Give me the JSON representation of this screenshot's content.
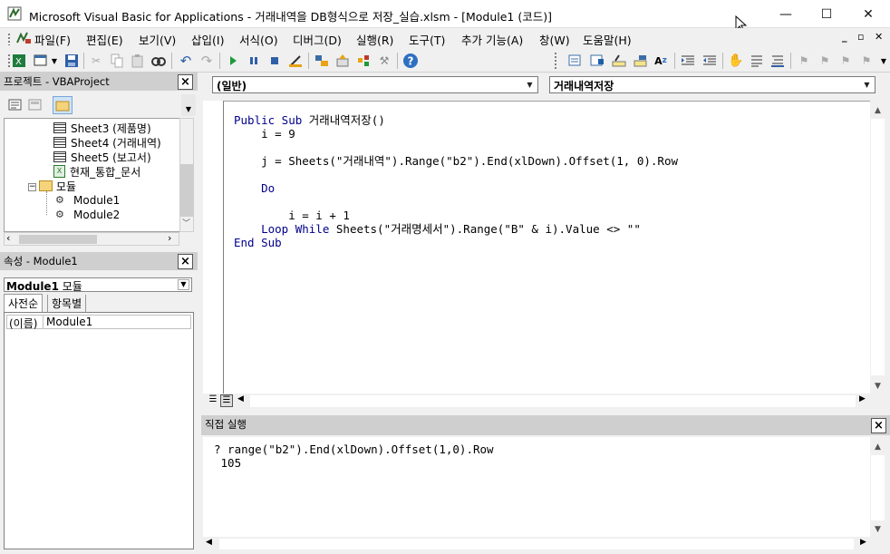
{
  "window": {
    "title": "Microsoft Visual Basic for Applications - 거래내역을 DB형식으로 저장_실습.xlsm - [Module1 (코드)]",
    "minimize_glyph": "—",
    "maximize_glyph": "☐",
    "close_glyph": "✕"
  },
  "menu": {
    "items": [
      "파일(F)",
      "편집(E)",
      "보기(V)",
      "삽입(I)",
      "서식(O)",
      "디버그(D)",
      "실행(R)",
      "도구(T)",
      "추가 기능(A)",
      "창(W)",
      "도움말(H)"
    ],
    "mdi_min": "_",
    "mdi_restore": "▫",
    "mdi_close": "✕"
  },
  "toolbar": {
    "icons": [
      "excel-icon",
      "insert-module-icon",
      "save-icon",
      "cut-icon",
      "copy-icon",
      "paste-icon",
      "find-icon",
      "undo-icon",
      "redo-icon",
      "run-icon",
      "break-icon",
      "reset-icon",
      "design-mode-icon",
      "project-explorer-icon",
      "properties-icon",
      "object-browser-icon",
      "toolbox-icon",
      "help-icon"
    ]
  },
  "project": {
    "title": "프로젝트 - VBAProject",
    "tree": [
      {
        "label": "Sheet3 (제품명)",
        "kind": "sheet"
      },
      {
        "label": "Sheet4 (거래내역)",
        "kind": "sheet"
      },
      {
        "label": "Sheet5 (보고서)",
        "kind": "sheet"
      },
      {
        "label": "현재_통합_문서",
        "kind": "workbook"
      },
      {
        "label": "모듈",
        "kind": "folder",
        "expander": "⊟"
      },
      {
        "label": "Module1",
        "kind": "module"
      },
      {
        "label": "Module2",
        "kind": "module"
      }
    ]
  },
  "properties": {
    "title": "속성 - Module1",
    "object_name": "Module1",
    "object_type": "모듈",
    "tabs": [
      "사전순",
      "항목별"
    ],
    "rows": [
      {
        "name": "(이름)",
        "value": "Module1"
      }
    ]
  },
  "code": {
    "object_combo": "(일반)",
    "proc_combo": "거래내역저장",
    "lines": [
      {
        "kw": "Public Sub ",
        "text": "거래내역저장()"
      },
      {
        "kw": "",
        "text": "    i = 9"
      },
      {
        "kw": "",
        "text": ""
      },
      {
        "kw": "",
        "text": "    j = Sheets(\"거래내역\").Range(\"b2\").End(xlDown).Offset(1, 0).Row"
      },
      {
        "kw": "",
        "text": ""
      },
      {
        "kw": "    Do",
        "text": ""
      },
      {
        "kw": "",
        "text": ""
      },
      {
        "kw": "",
        "text": "        i = i + 1"
      },
      {
        "kw": "    Loop While ",
        "text": "Sheets(\"거래명세서\").Range(\"B\" & i).Value <> \"\""
      },
      {
        "kw": "End Sub",
        "text": ""
      }
    ]
  },
  "immediate": {
    "title": "직접 실행",
    "lines": [
      "? range(\"b2\").End(xlDown).Offset(1,0).Row",
      " 105"
    ]
  }
}
